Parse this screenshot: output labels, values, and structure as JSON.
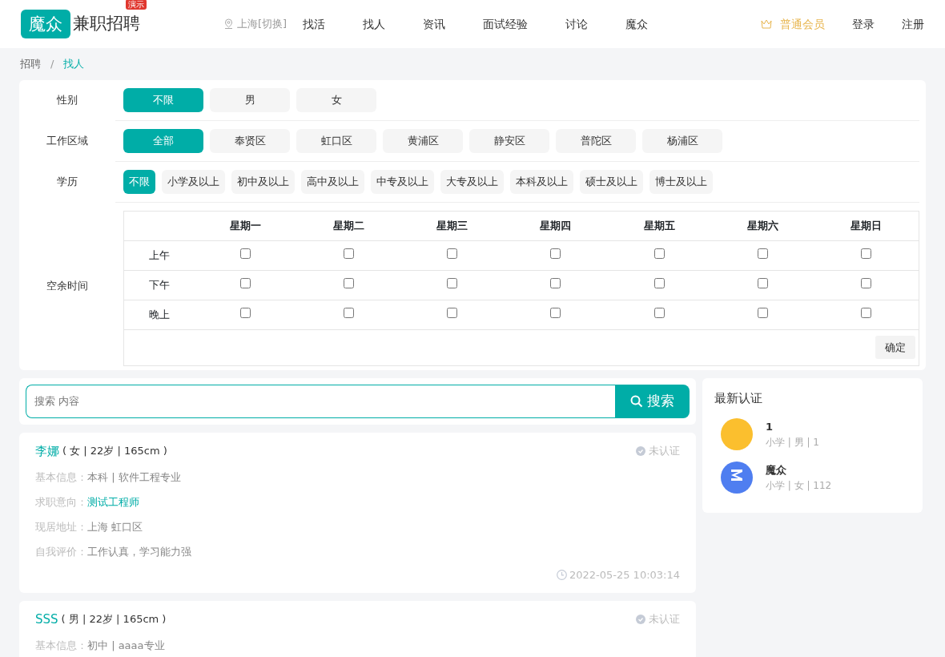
{
  "header": {
    "logo_mark": "魔众",
    "logo_text": "兼职招聘",
    "demo_badge": "演示",
    "city": "上海[切换]",
    "nav": [
      {
        "label": "找活",
        "selected": false
      },
      {
        "label": "找人",
        "selected": false
      },
      {
        "label": "资讯",
        "selected": false
      },
      {
        "label": "面试经验",
        "selected": false
      },
      {
        "label": "讨论",
        "selected": false
      },
      {
        "label": "魔众",
        "selected": false
      }
    ],
    "member": "普通会员",
    "login": "登录",
    "register": "注册"
  },
  "breadcrumb": [
    {
      "label": "招聘",
      "selected": false
    },
    {
      "label": "找人",
      "selected": true
    }
  ],
  "breadcrumb_separator": "/",
  "filters": [
    {
      "label": "性别",
      "kind": "fixed",
      "options": [
        {
          "label": "不限",
          "selected": true
        },
        {
          "label": "男",
          "selected": false
        },
        {
          "label": "女",
          "selected": false
        }
      ]
    },
    {
      "label": "工作区域",
      "kind": "fixed",
      "options": [
        {
          "label": "全部",
          "selected": true
        },
        {
          "label": "奉贤区",
          "selected": false
        },
        {
          "label": "虹口区",
          "selected": false
        },
        {
          "label": "黄浦区",
          "selected": false
        },
        {
          "label": "静安区",
          "selected": false
        },
        {
          "label": "普陀区",
          "selected": false
        },
        {
          "label": "杨浦区",
          "selected": false
        }
      ]
    },
    {
      "label": "学历",
      "kind": "fit",
      "options": [
        {
          "label": "不限",
          "selected": true
        },
        {
          "label": "小学及以上",
          "selected": false
        },
        {
          "label": "初中及以上",
          "selected": false
        },
        {
          "label": "高中及以上",
          "selected": false
        },
        {
          "label": "中专及以上",
          "selected": false
        },
        {
          "label": "大专及以上",
          "selected": false
        },
        {
          "label": "本科及以上",
          "selected": false
        },
        {
          "label": "硕士及以上",
          "selected": false
        },
        {
          "label": "博士及以上",
          "selected": false
        }
      ]
    }
  ],
  "schedule": {
    "label": "空余时间",
    "days": [
      "星期一",
      "星期二",
      "星期三",
      "星期四",
      "星期五",
      "星期六",
      "星期日"
    ],
    "rows": [
      {
        "label": "上午",
        "slots": [
          {
            "checked": false
          },
          {
            "checked": false
          },
          {
            "checked": false
          },
          {
            "checked": false
          },
          {
            "checked": false
          },
          {
            "checked": false
          },
          {
            "checked": false
          }
        ]
      },
      {
        "label": "下午",
        "slots": [
          {
            "checked": false
          },
          {
            "checked": false
          },
          {
            "checked": false
          },
          {
            "checked": false
          },
          {
            "checked": false
          },
          {
            "checked": false
          },
          {
            "checked": false
          }
        ]
      },
      {
        "label": "晚上",
        "slots": [
          {
            "checked": false
          },
          {
            "checked": false
          },
          {
            "checked": false
          },
          {
            "checked": false
          },
          {
            "checked": false
          },
          {
            "checked": false
          },
          {
            "checked": false
          }
        ]
      }
    ],
    "confirm": "确定"
  },
  "search": {
    "placeholder": "搜索 内容",
    "button": "搜索"
  },
  "people": [
    {
      "name": "李娜",
      "info": "( 女 | 22岁 | 165cm )",
      "status": "未认证",
      "fields": [
        {
          "label": "基本信息：",
          "value": "本科 | 软件工程专业",
          "kind": "plain"
        },
        {
          "label": "求职意向：",
          "value": "测试工程师",
          "kind": "link"
        },
        {
          "label": "现居地址：",
          "value": "上海 虹口区",
          "kind": "plain"
        },
        {
          "label": "自我评价：",
          "value": "工作认真，学习能力强",
          "kind": "plain"
        }
      ],
      "time": "2022-05-25 10:03:14"
    },
    {
      "name": "SSS",
      "info": "( 男 | 22岁 | 165cm )",
      "status": "未认证",
      "fields": [
        {
          "label": "基本信息：",
          "value": "初中 | aaaa专业",
          "kind": "plain"
        }
      ]
    }
  ],
  "latest": {
    "title": "最新认证",
    "items": [
      {
        "name": "1",
        "detail": "小学 | 男 | 1",
        "kind": "emoji",
        "color": "#fbbf2e"
      },
      {
        "name": "魔众",
        "detail": "小学 | 女 | 112",
        "kind": "logo",
        "color": "#4f7ef0"
      }
    ]
  }
}
